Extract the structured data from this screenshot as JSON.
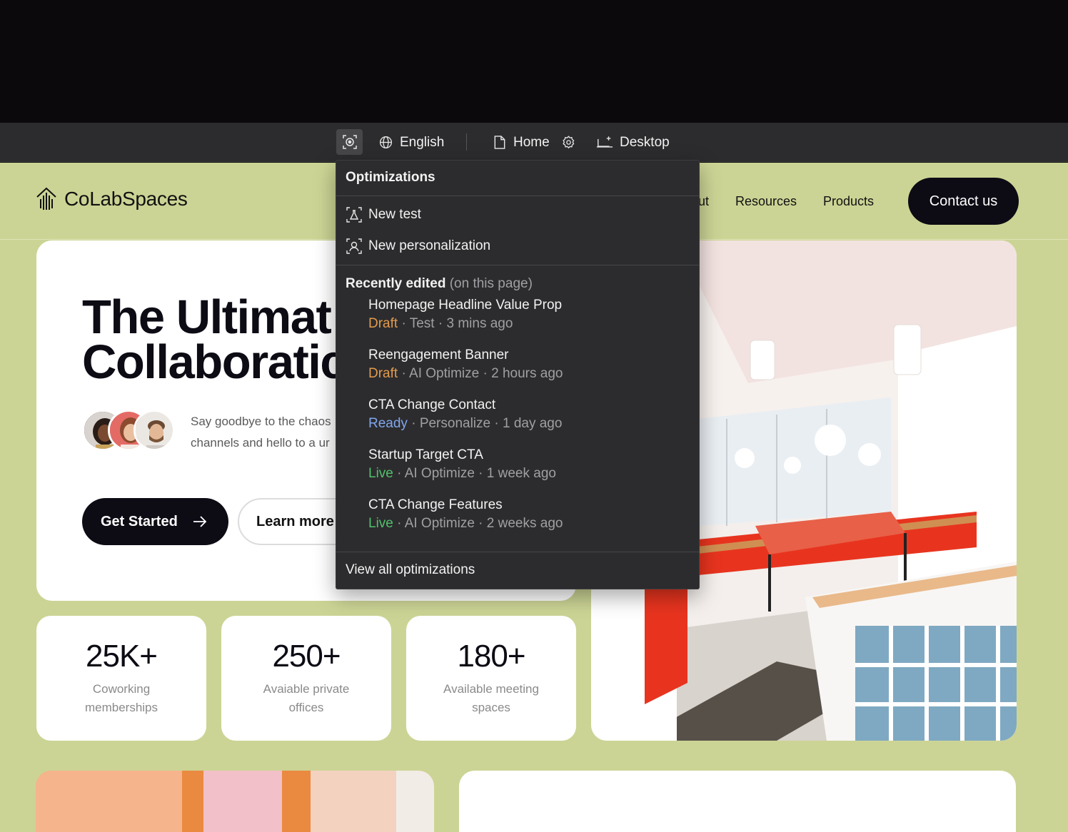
{
  "editor_bar": {
    "language": "English",
    "page": "Home",
    "device": "Desktop"
  },
  "site": {
    "logo_text": "CoLabSpaces",
    "nav": [
      "ut",
      "Resources",
      "Products"
    ],
    "contact_label": "Contact us",
    "hero": {
      "title_line1": "The Ultimat",
      "title_line2": "Collaboratic",
      "subtitle": "Say goodbye to the chaos channels and hello to a ur",
      "primary_cta": "Get Started",
      "secondary_cta": "Learn more"
    },
    "stats": [
      {
        "value": "25K+",
        "label": "Coworking memberships"
      },
      {
        "value": "250+",
        "label": "Avaiable private offices"
      },
      {
        "value": "180+",
        "label": "Available meeting spaces"
      }
    ]
  },
  "dropdown": {
    "header": "Optimizations",
    "actions": [
      "New test",
      "New personalization"
    ],
    "section_title": "Recently edited",
    "section_note": "(on this page)",
    "items": [
      {
        "title": "Homepage Headline Value Prop",
        "status": "Draft",
        "type": "Test",
        "time": "3 mins ago"
      },
      {
        "title": "Reengagement Banner",
        "status": "Draft",
        "type": "AI Optimize",
        "time": "2 hours ago"
      },
      {
        "title": "CTA Change Contact",
        "status": "Ready",
        "type": "Personalize",
        "time": "1 day ago"
      },
      {
        "title": "Startup Target CTA",
        "status": "Live",
        "type": "AI Optimize",
        "time": "1 week ago"
      },
      {
        "title": "CTA Change Features",
        "status": "Live",
        "type": "AI Optimize",
        "time": "2 weeks ago"
      }
    ],
    "footer": "View all optimizations"
  },
  "colors": {
    "site_background": "#ccd495",
    "editor_bar": "#2c2c2e",
    "draft": "#e49a4e",
    "ready": "#80a6ee",
    "live": "#52c06c",
    "button_dark": "#0d0b14"
  },
  "icons": {
    "focus": "focus-target-icon",
    "language": "globe-icon",
    "page": "page-icon",
    "settings": "gear-icon",
    "device": "desktop-sparkle-icon",
    "new_test": "flask-icon",
    "new_personalization": "user-focus-icon",
    "arrow": "arrow-right-icon",
    "logo": "logo-icon"
  }
}
